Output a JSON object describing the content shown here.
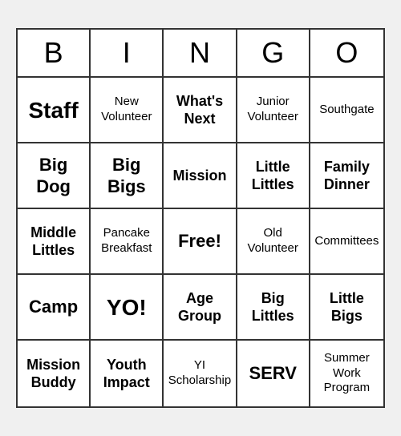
{
  "header": {
    "letters": [
      "B",
      "I",
      "N",
      "G",
      "O"
    ]
  },
  "cells": [
    {
      "text": "Staff",
      "size": "xlarge"
    },
    {
      "text": "New\nVolunteer",
      "size": "normal"
    },
    {
      "text": "What's\nNext",
      "size": "medium"
    },
    {
      "text": "Junior\nVolunteer",
      "size": "normal"
    },
    {
      "text": "Southgate",
      "size": "normal"
    },
    {
      "text": "Big\nDog",
      "size": "large"
    },
    {
      "text": "Big\nBigs",
      "size": "large"
    },
    {
      "text": "Mission",
      "size": "medium"
    },
    {
      "text": "Little\nLittles",
      "size": "medium"
    },
    {
      "text": "Family\nDinner",
      "size": "medium"
    },
    {
      "text": "Middle\nLittles",
      "size": "medium"
    },
    {
      "text": "Pancake\nBreakfast",
      "size": "normal"
    },
    {
      "text": "Free!",
      "size": "free"
    },
    {
      "text": "Old\nVolunteer",
      "size": "normal"
    },
    {
      "text": "Committees",
      "size": "normal"
    },
    {
      "text": "Camp",
      "size": "large"
    },
    {
      "text": "YO!",
      "size": "xlarge"
    },
    {
      "text": "Age\nGroup",
      "size": "medium"
    },
    {
      "text": "Big\nLittles",
      "size": "medium"
    },
    {
      "text": "Little\nBigs",
      "size": "medium"
    },
    {
      "text": "Mission\nBuddy",
      "size": "medium"
    },
    {
      "text": "Youth\nImpact",
      "size": "medium"
    },
    {
      "text": "YI\nScholarship",
      "size": "normal"
    },
    {
      "text": "SERV",
      "size": "large"
    },
    {
      "text": "Summer\nWork\nProgram",
      "size": "normal"
    }
  ]
}
